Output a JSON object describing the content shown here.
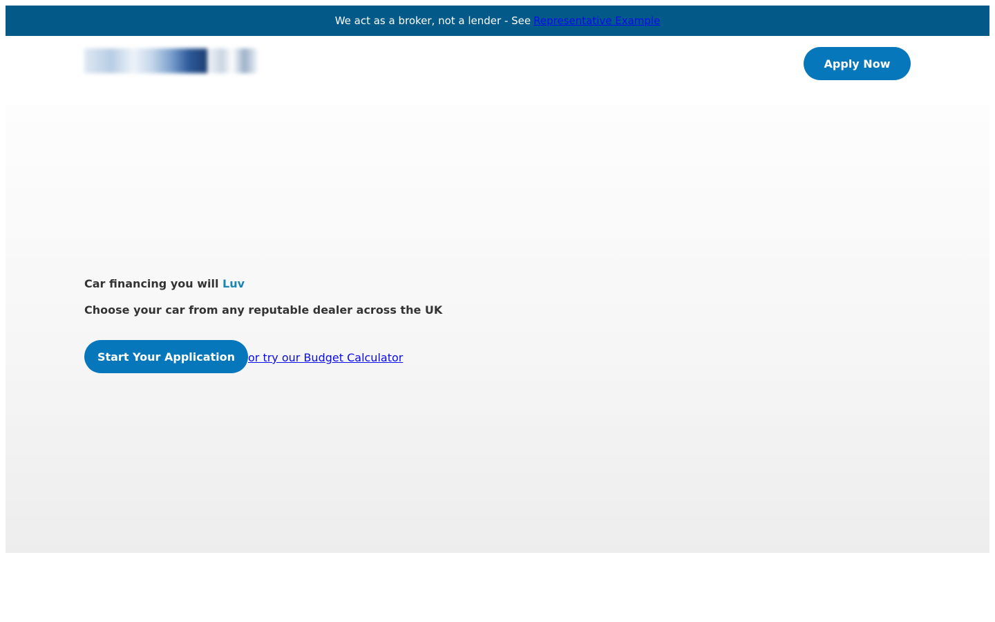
{
  "banner": {
    "text": "We act as a broker, not a lender - See",
    "link_label": "Representative Example"
  },
  "header": {
    "logo_name": "luv-logo",
    "apply_label": "Apply Now"
  },
  "hero": {
    "title_prefix": "Car financing you will",
    "title_accent": "Luv",
    "subtitle": "Choose your car from any reputable dealer across the UK",
    "start_label": "Start Your Application",
    "budget_link_label": "or try our Budget Calculator"
  },
  "colors": {
    "banner_bg": "#035a88",
    "button_bg": "#0777bb",
    "accent_text": "#1a86b3",
    "link": "#0a0aee",
    "body_text": "#333333"
  }
}
